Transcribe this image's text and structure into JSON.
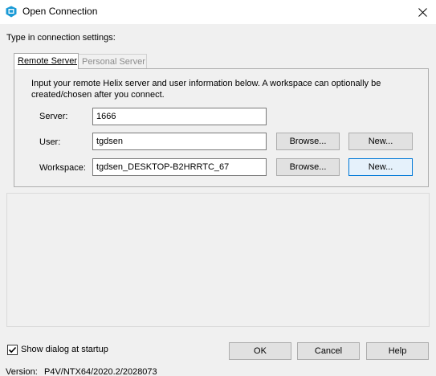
{
  "window": {
    "title": "Open Connection",
    "accent": "#0078d7"
  },
  "prompt": "Type in connection settings:",
  "tabs": [
    {
      "label": "Remote Server",
      "selected": true
    },
    {
      "label": "Personal Server",
      "selected": false
    }
  ],
  "remote": {
    "info": "Input your remote Helix server and user information below. A workspace can optionally be created/chosen after you connect.",
    "server": {
      "label": "Server:",
      "value": "1666"
    },
    "user": {
      "label": "User:",
      "value": "tgdsen",
      "browse": "Browse...",
      "new": "New..."
    },
    "workspace": {
      "label": "Workspace:",
      "value": "tgdsen_DESKTOP-B2HRRTC_67",
      "browse": "Browse...",
      "new": "New..."
    }
  },
  "footer": {
    "show_dialog": {
      "label": "Show dialog at startup",
      "checked": true
    },
    "ok": "OK",
    "cancel": "Cancel",
    "help": "Help",
    "version_label": "Version:",
    "version_value": "P4V/NTX64/2020.2/2028073"
  }
}
